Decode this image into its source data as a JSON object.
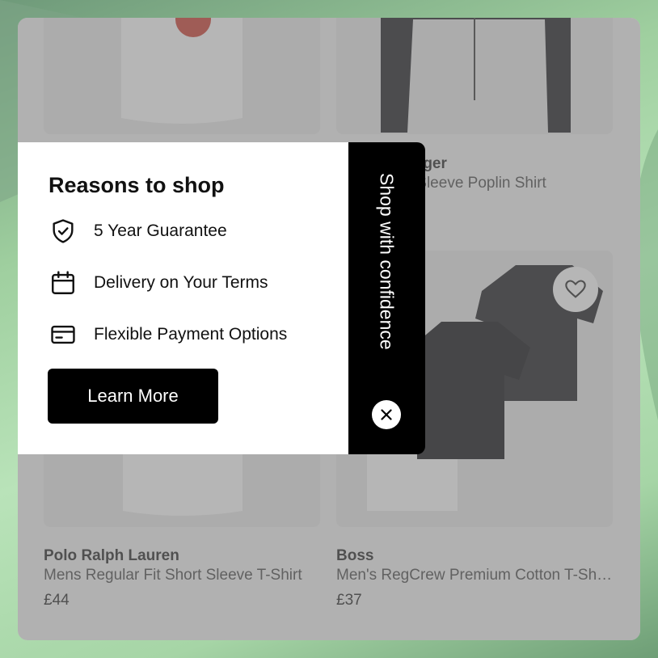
{
  "popup": {
    "heading": "Reasons to shop",
    "reasons": [
      {
        "label": "5 Year Guarantee",
        "icon": "shield-check-icon"
      },
      {
        "label": "Delivery on Your Terms",
        "icon": "calendar-icon"
      },
      {
        "label": "Flexible Payment Options",
        "icon": "credit-card-icon"
      }
    ],
    "button_label": "Learn More",
    "side_tab_label": "Shop with confidence",
    "close_icon": "close-icon"
  },
  "products": [
    {
      "brand": "",
      "title": "",
      "price": ""
    },
    {
      "brand": "Tommy Hilfiger",
      "title": "Mens Long Sleeve Poplin Shirt",
      "price": ""
    },
    {
      "brand": "",
      "title": "",
      "price": ""
    },
    {
      "brand": "",
      "title": "",
      "price": "",
      "wishlist_icon": "heart-icon"
    },
    {
      "brand": "Polo Ralph Lauren",
      "title": "Mens Regular Fit Short Sleeve T-Shirt",
      "price": "£44"
    },
    {
      "brand": "Boss",
      "title": "Men's RegCrew Premium Cotton T-Shirts",
      "price": "£37"
    }
  ],
  "colors": {
    "popup_background": "#ffffff",
    "button_background": "#000000",
    "overlay": "#6e6e6e",
    "backdrop_green": "#a6d5a6"
  }
}
